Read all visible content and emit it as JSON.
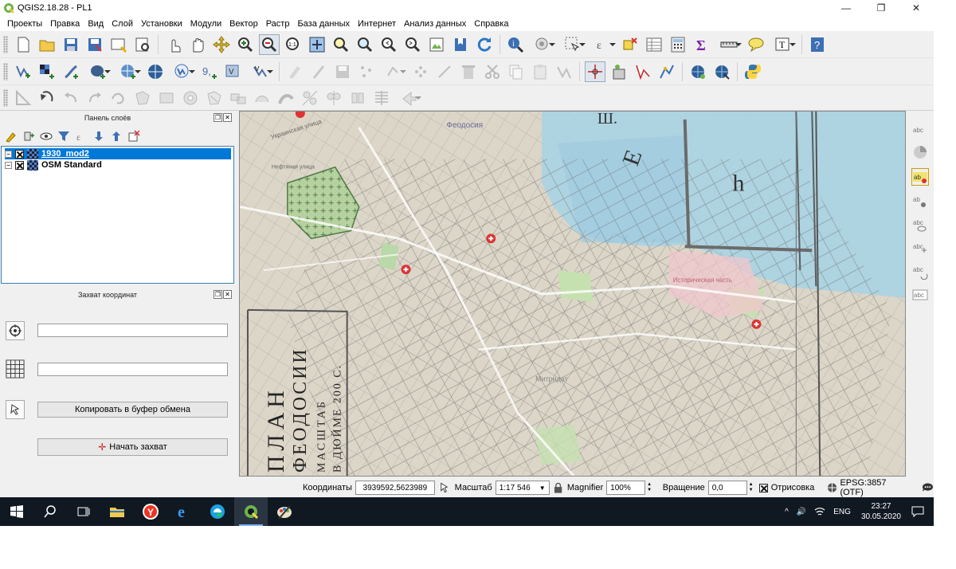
{
  "window": {
    "title": "QGIS2.18.28 - PL1",
    "minimize": "—",
    "restore": "❐",
    "close": "✕"
  },
  "menu": [
    "Проекты",
    "Правка",
    "Вид",
    "Слой",
    "Установки",
    "Модули",
    "Вектор",
    "Растр",
    "База данных",
    "Интернет",
    "Анализ данных",
    "Справка"
  ],
  "layers_panel": {
    "title": "Панель слоёв",
    "layers": [
      {
        "name": "1930_mod2",
        "checked": true,
        "selected": true
      },
      {
        "name": "OSM Standard",
        "checked": true,
        "selected": false
      }
    ]
  },
  "capture_panel": {
    "title": "Захват координат",
    "field1_value": "",
    "field2_value": "",
    "copy_button": "Копировать в буфер обмена",
    "start_button": "Начать захват"
  },
  "map": {
    "labels": {
      "feodosia": "Феодосия",
      "ukr_street": "Украинская улица",
      "neft_street": "Нефтяная улица",
      "mitridat": "Митридат",
      "plan_title": "ПЛАН",
      "plan_city": "ФЕОДОСИИ",
      "plan_scale": "МАСШТАБ",
      "plan_scale2": "В ДЮЙМЕ 200 С.",
      "old_part": "Историческая часть",
      "sea_letter1": "Ш.",
      "sea_letter2": "Е",
      "sea_letter3": "h"
    }
  },
  "statusbar": {
    "coords_label": "Координаты",
    "coords_value": "3939592,5623989",
    "scale_label": "Масштаб",
    "scale_value": "1:17 546",
    "magnifier_label": "Magnifier",
    "magnifier_value": "100%",
    "rotation_label": "Вращение",
    "rotation_value": "0,0",
    "render_label": "Отрисовка",
    "crs_label": "EPSG:3857 (OTF)"
  },
  "taskbar": {
    "lang": "ENG",
    "time": "23:27",
    "date": "30.05.2020"
  },
  "colors": {
    "selection": "#0078d7",
    "taskbar": "#101822",
    "sea": "#a9d3e3",
    "qgis_green": "#6fb34a"
  }
}
